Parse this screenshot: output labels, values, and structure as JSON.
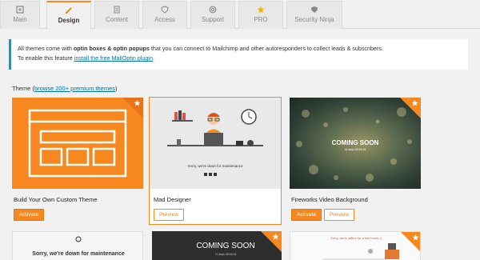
{
  "tabs": [
    {
      "label": "Main",
      "icon": "home-icon"
    },
    {
      "label": "Design",
      "icon": "brush-icon"
    },
    {
      "label": "Content",
      "icon": "document-icon"
    },
    {
      "label": "Access",
      "icon": "shield-icon"
    },
    {
      "label": "Support",
      "icon": "lifebuoy-icon"
    },
    {
      "label": "PRO",
      "icon": "star-icon"
    },
    {
      "label": "Security Ninja",
      "icon": "shield-check-icon"
    }
  ],
  "info": {
    "text_1": "All themes come with ",
    "bold_1": "optin boxes & optin popups",
    "text_2": " that you can connect to Mailchimp and other autoresponders to collect leads & subscribers.",
    "text_3": "To enable this feature ",
    "link": "install the free MailOptin plugin",
    "text_4": "."
  },
  "theme_section": {
    "label": "Theme",
    "open_paren": " (",
    "link": "browse 200+ premium themes",
    "close_paren": ")"
  },
  "cards": [
    {
      "title": "Build Your Own Custom Theme",
      "button": "Activate"
    },
    {
      "title": "Mad Designer",
      "button": "Preview",
      "thumb_title": "Sorry, we're down for maintenance"
    },
    {
      "title": "Fireworks Video Background",
      "button_1": "Activate",
      "button_2": "Preview",
      "thumb_title": "COMING SOON",
      "thumb_sub": "44 days 05:04:16"
    }
  ],
  "bottom_cards": [
    {
      "thumb_title": "Sorry, we're down for maintenance"
    },
    {
      "thumb_title": "COMING SOON",
      "thumb_sub": "71 days 05:04:16"
    },
    {
      "thumb_title": "Sorry, we're offline for a few hours :("
    }
  ],
  "colors": {
    "accent": "#f7881f",
    "link": "#0073aa",
    "info_border": "#00a0d2"
  }
}
